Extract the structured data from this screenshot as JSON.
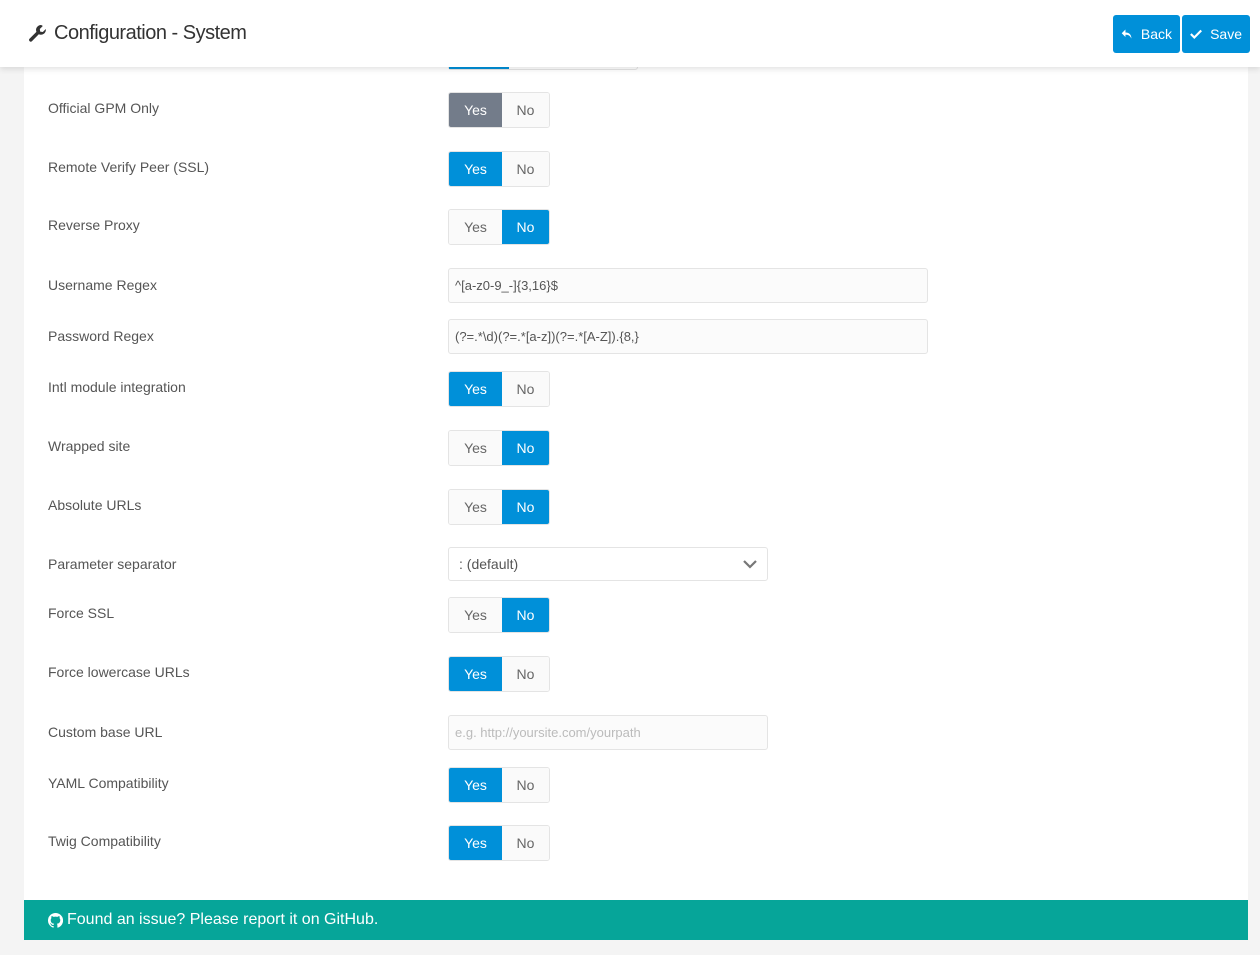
{
  "header": {
    "title": "Configuration - System",
    "back_label": "Back",
    "save_label": "Save"
  },
  "rows": [
    {
      "label": "Official GPM Only",
      "type": "toggle",
      "value": "Yes"
    },
    {
      "label": "Remote Verify Peer (SSL)",
      "type": "toggle",
      "value": "Yes"
    },
    {
      "label": "Reverse Proxy",
      "type": "toggle",
      "value": "No"
    },
    {
      "label": "Username Regex",
      "type": "input",
      "value": "^[a-z0-9_-]{3,16}$"
    },
    {
      "label": "Password Regex",
      "type": "input",
      "value": "(?=.*\\d)(?=.*[a-z])(?=.*[A-Z]).{8,}"
    },
    {
      "label": "Intl module integration",
      "type": "toggle",
      "value": "Yes"
    },
    {
      "label": "Wrapped site",
      "type": "toggle",
      "value": "No"
    },
    {
      "label": "Absolute URLs",
      "type": "toggle",
      "value": "No"
    },
    {
      "label": "Parameter separator",
      "type": "select",
      "value": ": (default)"
    },
    {
      "label": "Force SSL",
      "type": "toggle",
      "value": "No"
    },
    {
      "label": "Force lowercase URLs",
      "type": "toggle",
      "value": "Yes"
    },
    {
      "label": "Custom base URL",
      "type": "input",
      "value": "",
      "placeholder": "e.g. http://yoursite.com/yourpath"
    },
    {
      "label": "YAML Compatibility",
      "type": "toggle",
      "value": "Yes"
    },
    {
      "label": "Twig Compatibility",
      "type": "toggle",
      "value": "Yes"
    }
  ],
  "toggle": {
    "yes": "Yes",
    "no": "No"
  },
  "footer": {
    "text": "Found an issue? Please report it on GitHub."
  }
}
